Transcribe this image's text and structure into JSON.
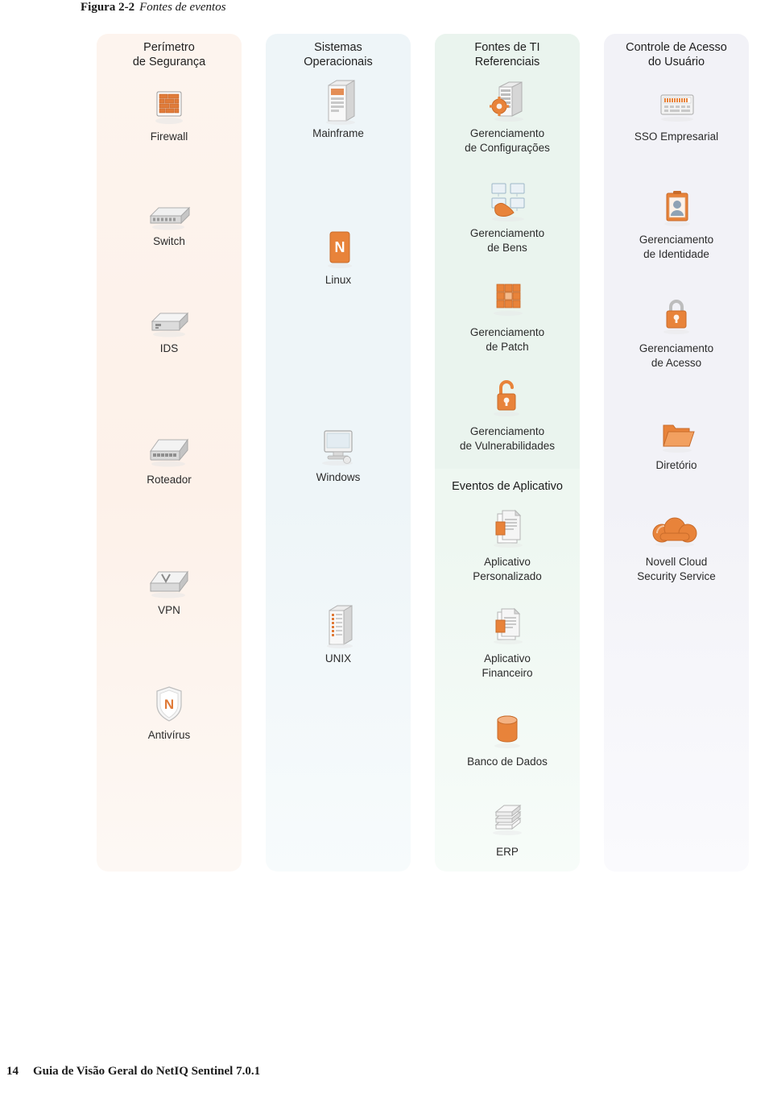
{
  "caption": {
    "figure_number": "Figura 2-2",
    "title": "Fontes de eventos"
  },
  "columns": [
    {
      "id": "perimeter",
      "heading": "Perímetro\nde Segurança",
      "heading_line1": "Perímetro",
      "heading_line2": "de Segurança",
      "accent": "#f6ece4",
      "items": [
        {
          "icon": "firewall-icon",
          "label": "Firewall"
        },
        {
          "icon": "switch-icon",
          "label": "Switch"
        },
        {
          "icon": "ids-icon",
          "label": "IDS"
        },
        {
          "icon": "router-icon",
          "label": "Roteador"
        },
        {
          "icon": "vpn-icon",
          "label": "VPN"
        },
        {
          "icon": "antivirus-icon",
          "label": "Antivírus"
        }
      ]
    },
    {
      "id": "operating-systems",
      "heading_line1": "Sistemas",
      "heading_line2": "Operacionais",
      "accent": "#eaf3f7",
      "items": [
        {
          "icon": "mainframe-icon",
          "label": "Mainframe"
        },
        {
          "icon": "linux-icon",
          "label": "Linux"
        },
        {
          "icon": "windows-icon",
          "label": "Windows"
        },
        {
          "icon": "unix-icon",
          "label": "UNIX"
        }
      ]
    },
    {
      "id": "referential-it-sources",
      "heading_line1": "Fontes de TI",
      "heading_line2": "Referenciais",
      "accent": "#e9f4ed",
      "items": [
        {
          "icon": "settings-management-icon",
          "label": "Gerenciamento\nde Configurações",
          "label_line1": "Gerenciamento",
          "label_line2": "de Configurações"
        },
        {
          "icon": "asset-management-icon",
          "label_line1": "Gerenciamento",
          "label_line2": "de Bens"
        },
        {
          "icon": "patch-management-icon",
          "label_line1": "Gerenciamento",
          "label_line2": "de Patch"
        },
        {
          "icon": "vulnerability-management-icon",
          "label_line1": "Gerenciamento",
          "label_line2": "de Vulnerabilidades"
        }
      ],
      "subsection_title": "Eventos de Aplicativo",
      "subsection_items": [
        {
          "icon": "custom-application-icon",
          "label_line1": "Aplicativo",
          "label_line2": "Personalizado"
        },
        {
          "icon": "financial-application-icon",
          "label_line1": "Aplicativo",
          "label_line2": "Financeiro"
        },
        {
          "icon": "database-icon",
          "label_line1": "Banco de Dados",
          "label_line2": ""
        },
        {
          "icon": "erp-icon",
          "label_line1": "ERP",
          "label_line2": ""
        }
      ]
    },
    {
      "id": "user-access-control",
      "heading_line1": "Controle de Acesso",
      "heading_line2": "do Usuário",
      "accent": "#f1f1f6",
      "items": [
        {
          "icon": "sso-icon",
          "label_line1": "SSO Empresarial",
          "label_line2": ""
        },
        {
          "icon": "identity-management-icon",
          "label_line1": "Gerenciamento",
          "label_line2": "de Identidade"
        },
        {
          "icon": "access-management-icon",
          "label_line1": "Gerenciamento",
          "label_line2": "de Acesso"
        },
        {
          "icon": "directory-icon",
          "label_line1": "Diretório",
          "label_line2": ""
        },
        {
          "icon": "cloud-security-icon",
          "label_line1": "Novell Cloud",
          "label_line2": "Security Service"
        }
      ]
    }
  ],
  "footer": {
    "page_number": "14",
    "text": "Guia de Visão Geral do NetIQ Sentinel 7.0.1"
  }
}
